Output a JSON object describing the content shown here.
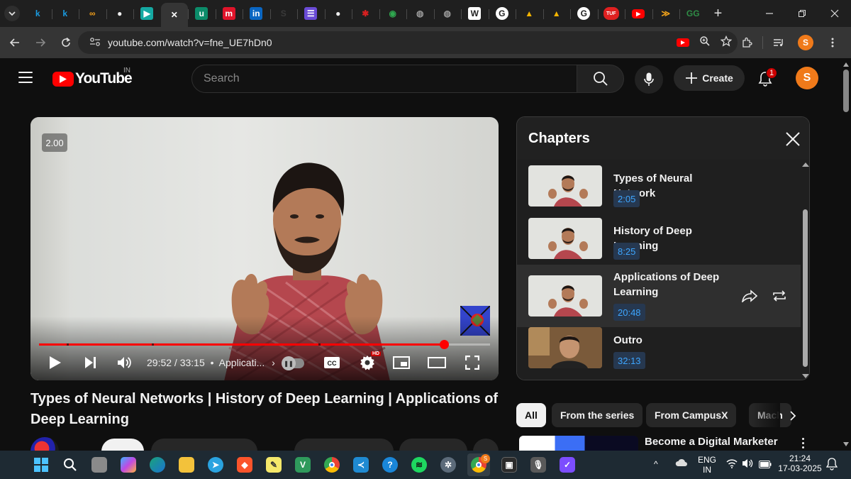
{
  "browser": {
    "tabs": [
      {
        "icon": "k-icon",
        "glyph": "k",
        "color": "#1a9be0"
      },
      {
        "icon": "k-icon",
        "glyph": "k",
        "color": "#1a9be0"
      },
      {
        "icon": "infinity-icon",
        "glyph": "∞",
        "color": "#f29f1a"
      },
      {
        "icon": "github-icon",
        "glyph": "●",
        "color": "#eeeeee"
      },
      {
        "icon": "app-icon",
        "glyph": "▶",
        "color": "#15a9a2"
      },
      {
        "icon": "close-icon",
        "glyph": "✕",
        "color": "#ffffff",
        "active": true
      },
      {
        "icon": "u-icon",
        "glyph": "u",
        "color": "#0c8c6a"
      },
      {
        "icon": "m-icon",
        "glyph": "m",
        "color": "#e0142a"
      },
      {
        "icon": "linkedin-icon",
        "glyph": "in",
        "color": "#0a66c2"
      },
      {
        "icon": "s-icon",
        "glyph": "S",
        "color": "#3a3a3a"
      },
      {
        "icon": "list-icon",
        "glyph": "☰",
        "color": "#6a4bd6"
      },
      {
        "icon": "github-icon",
        "glyph": "●",
        "color": "#eeeeee"
      },
      {
        "icon": "bug-icon",
        "glyph": "✱",
        "color": "#d62020"
      },
      {
        "icon": "color-wheel-icon",
        "glyph": "◉",
        "color": "#2fa84f"
      },
      {
        "icon": "globe-icon",
        "glyph": "◍",
        "color": "#9a9a9a"
      },
      {
        "icon": "globe-icon",
        "glyph": "◍",
        "color": "#9a9a9a"
      },
      {
        "icon": "wikipedia-icon",
        "glyph": "W",
        "color": "#ffffff"
      },
      {
        "icon": "google-icon",
        "glyph": "G",
        "color": "#ffffff"
      },
      {
        "icon": "drive-icon",
        "glyph": "▲",
        "color": "#f4b400"
      },
      {
        "icon": "drive-icon",
        "glyph": "▲",
        "color": "#f4b400"
      },
      {
        "icon": "google-icon",
        "glyph": "G",
        "color": "#ffffff"
      },
      {
        "icon": "tuf-icon",
        "glyph": "TUF",
        "color": "#e02020"
      },
      {
        "icon": "youtube-icon",
        "glyph": "▶",
        "color": "#ff0000"
      },
      {
        "icon": "ai-icon",
        "glyph": "≫",
        "color": "#f2a31a"
      },
      {
        "icon": "gfg-icon",
        "glyph": "GG",
        "color": "#2f8d46"
      }
    ],
    "url": "youtube.com/watch?v=fne_UE7hDn0"
  },
  "youtube": {
    "logo_text": "YouTube",
    "country_code": "IN",
    "search_placeholder": "Search",
    "create_label": "Create",
    "notification_count": "1",
    "avatar_letter": "S"
  },
  "player": {
    "speed_badge": "2.00",
    "time_display": "29:52 / 33:15",
    "separator": "•",
    "chapter_short": "Applicati...",
    "progress_fraction": 0.898,
    "chapter_marks": [
      0.062,
      0.25,
      0.62
    ]
  },
  "video": {
    "title": "Types of Neural Networks | History of Deep Learning | Applications of Deep Learning"
  },
  "chapters_panel": {
    "title": "Chapters",
    "items": [
      {
        "name": "Types of Neural Network",
        "time": "2:05",
        "active": false
      },
      {
        "name": "History of Deep Learning",
        "time": "8:25",
        "active": false
      },
      {
        "name": "Applications of Deep Learning",
        "time": "20:48",
        "active": true
      },
      {
        "name": "Outro",
        "time": "32:13",
        "active": false
      }
    ]
  },
  "chips": [
    {
      "label": "All",
      "selected": true
    },
    {
      "label": "From the series",
      "selected": false
    },
    {
      "label": "From CampusX",
      "selected": false
    },
    {
      "label": "Mach",
      "selected": false
    }
  ],
  "recommendation": {
    "title": "Become a Digital Marketer"
  },
  "taskbar": {
    "language": "ENG",
    "region": "IN",
    "time": "21:24",
    "date": "17-03-2025",
    "chrome_badge": "S"
  }
}
